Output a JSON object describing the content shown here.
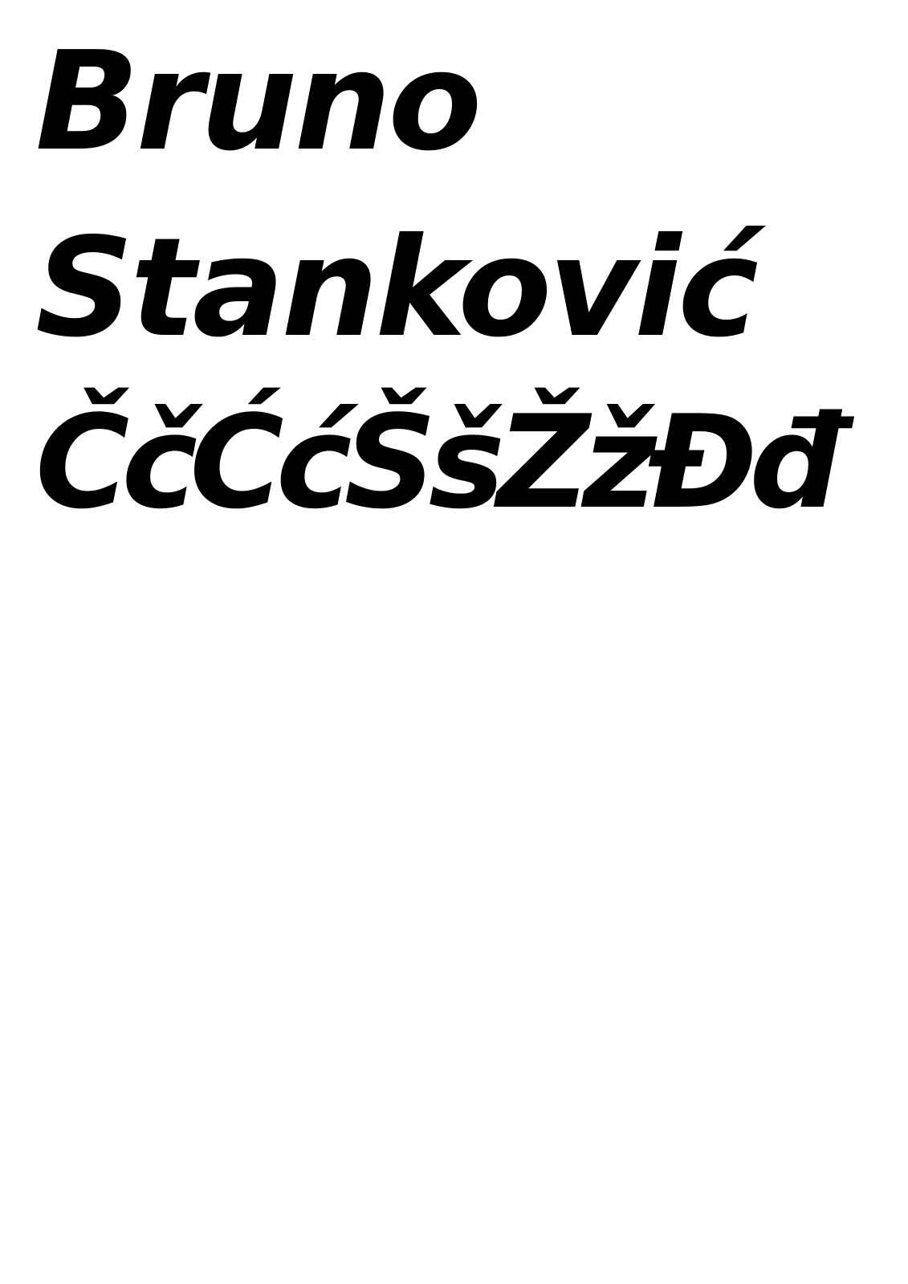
{
  "document": {
    "lines": [
      "Bruno",
      "Stanković",
      "ČčĆćŠšŽžĐđ"
    ]
  }
}
